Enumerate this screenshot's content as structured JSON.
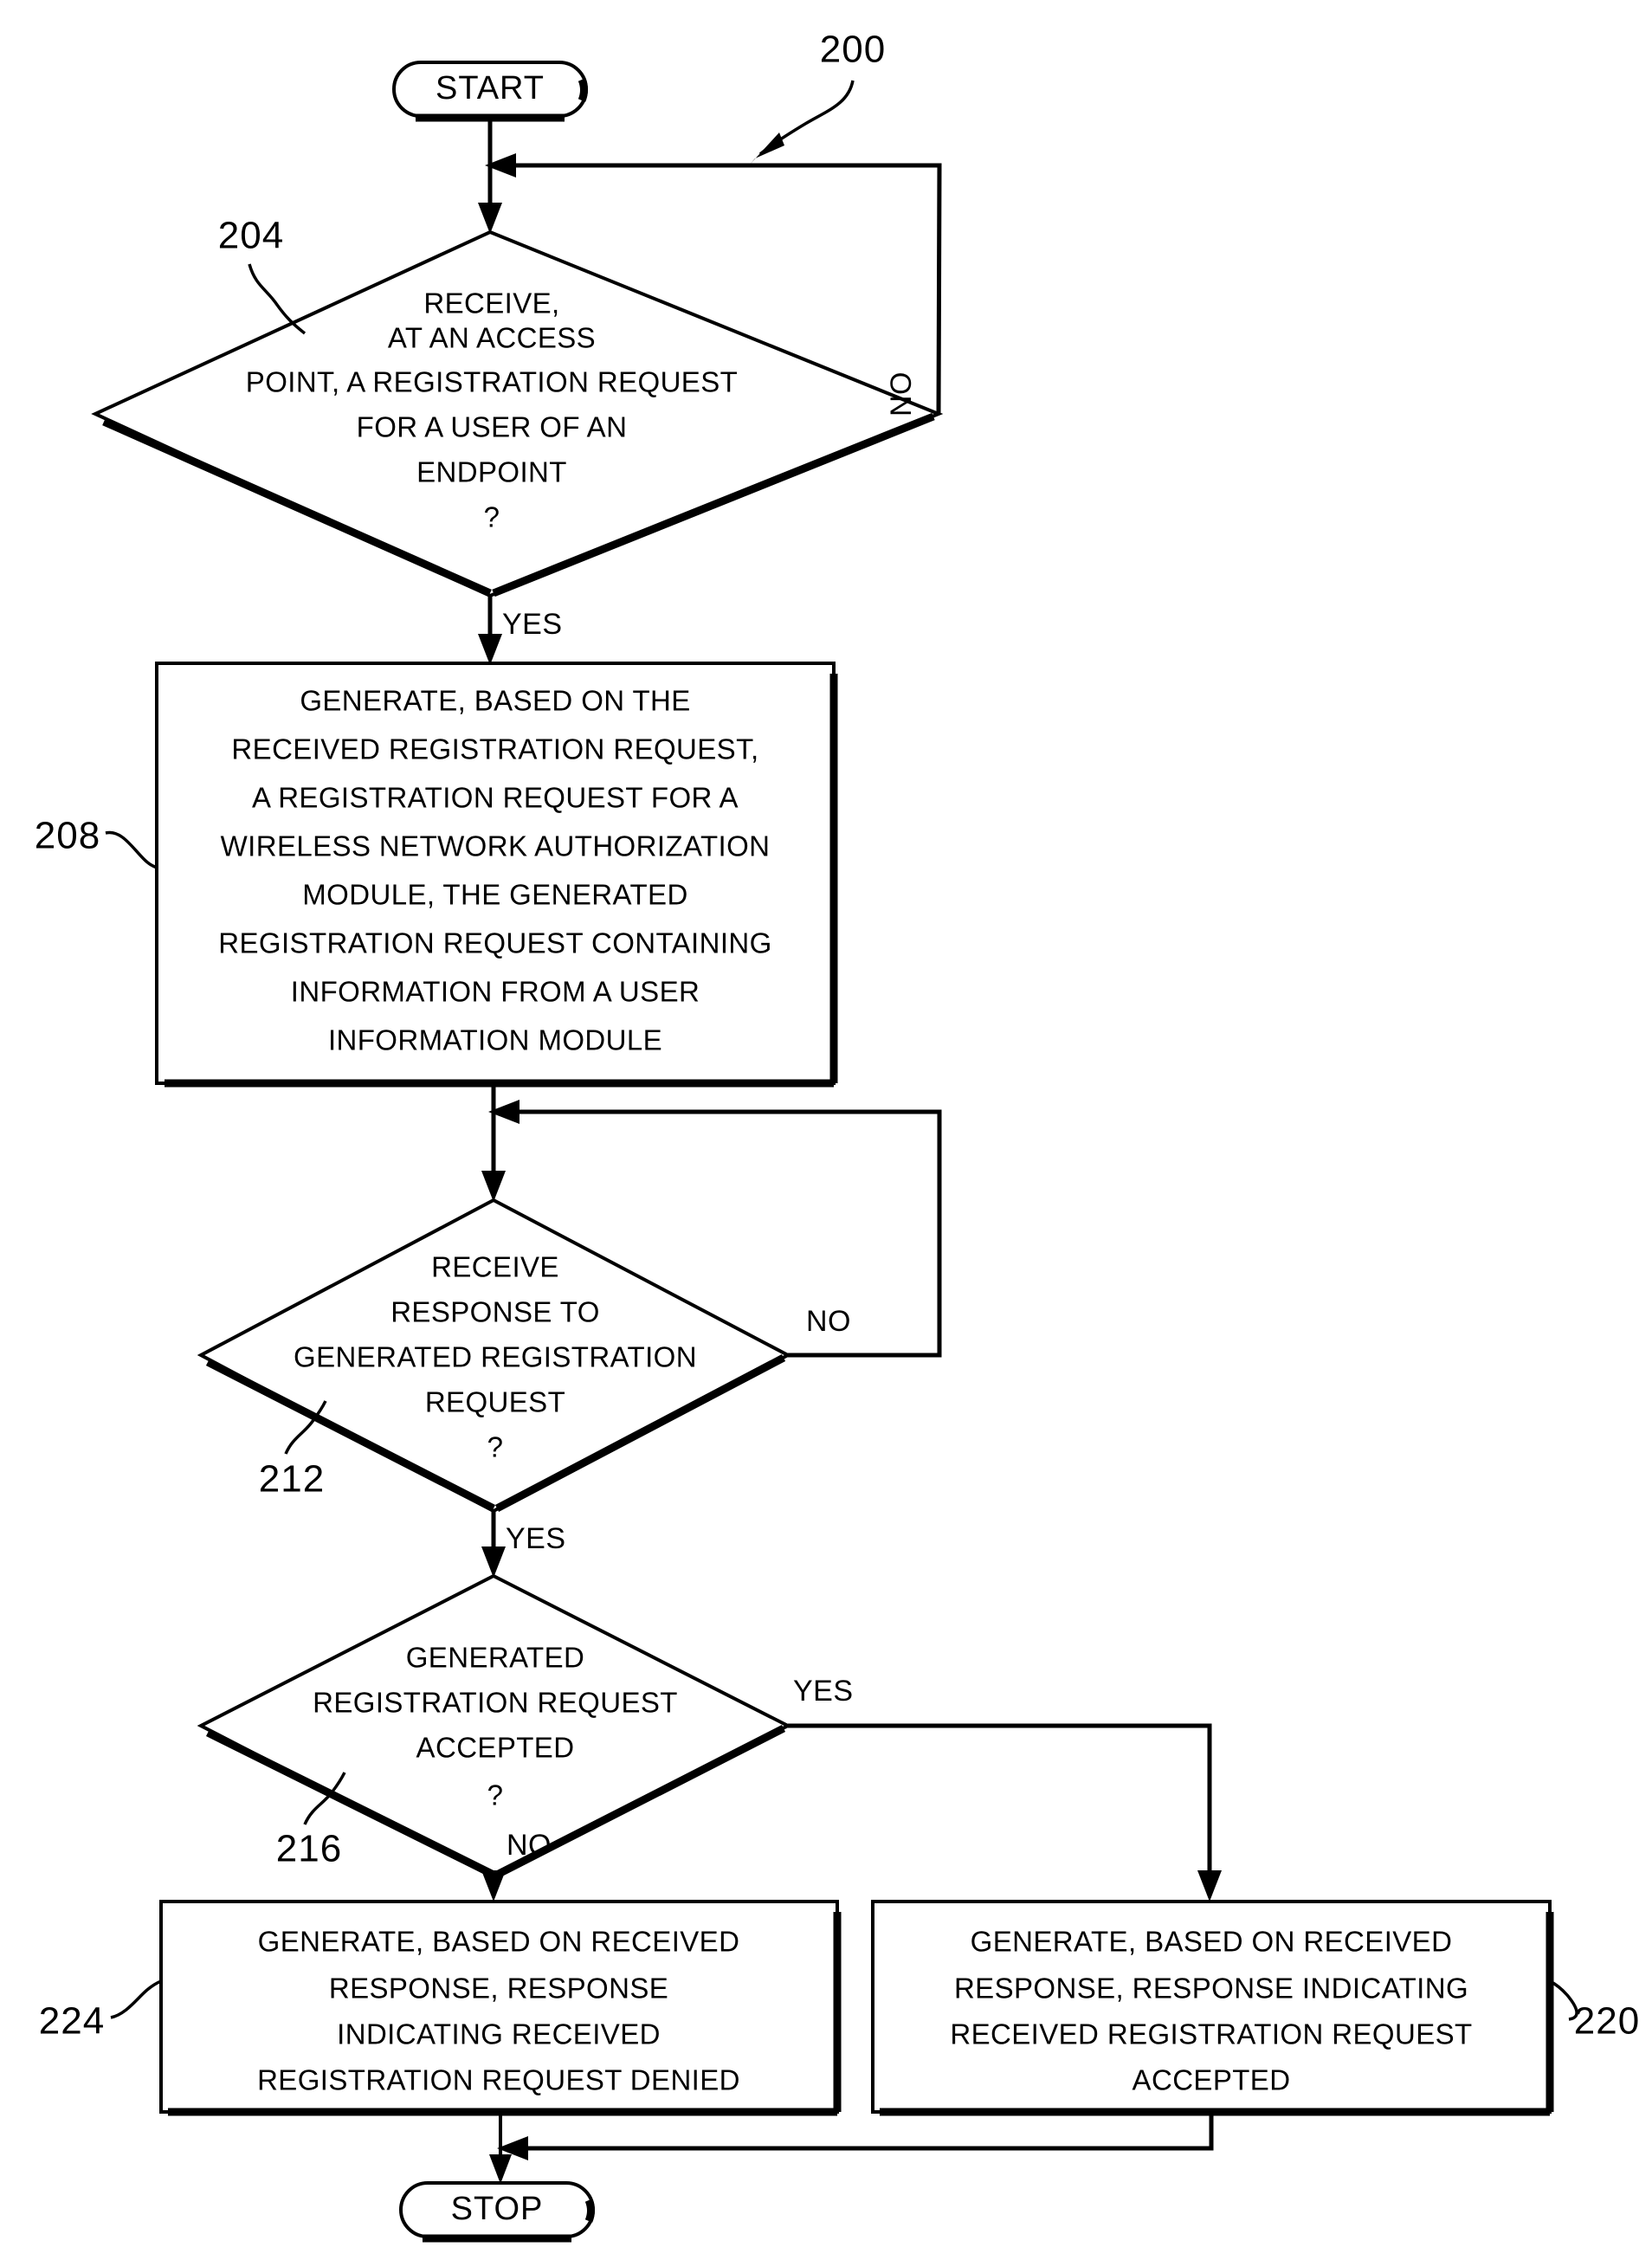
{
  "figure": {
    "reference_number": "200",
    "type": "patent-flowchart"
  },
  "nodes": {
    "start": {
      "label": "START",
      "shape": "terminator"
    },
    "decision_204": {
      "ref": "204",
      "shape": "diamond",
      "lines": [
        "RECEIVE,",
        "AT AN ACCESS",
        "POINT, A REGISTRATION REQUEST",
        "FOR A USER OF AN",
        "ENDPOINT",
        "?"
      ],
      "branch_no": "NO",
      "branch_yes": "YES"
    },
    "process_208": {
      "ref": "208",
      "shape": "rectangle",
      "lines": [
        "GENERATE, BASED ON THE",
        "RECEIVED REGISTRATION REQUEST,",
        "A REGISTRATION REQUEST FOR A",
        "WIRELESS NETWORK AUTHORIZATION",
        "MODULE, THE GENERATED",
        "REGISTRATION REQUEST CONTAINING",
        "INFORMATION FROM A USER",
        "INFORMATION MODULE"
      ]
    },
    "decision_212": {
      "ref": "212",
      "shape": "diamond",
      "lines": [
        "RECEIVE",
        "RESPONSE TO",
        "GENERATED REGISTRATION",
        "REQUEST",
        "?"
      ],
      "branch_no": "NO",
      "branch_yes": "YES"
    },
    "decision_216": {
      "ref": "216",
      "shape": "diamond",
      "lines": [
        "GENERATED",
        "REGISTRATION REQUEST",
        "ACCEPTED",
        "?"
      ],
      "branch_yes": "YES",
      "branch_no": "NO"
    },
    "process_224": {
      "ref": "224",
      "shape": "rectangle",
      "lines": [
        "GENERATE, BASED ON RECEIVED",
        "RESPONSE, RESPONSE",
        "INDICATING RECEIVED",
        "REGISTRATION REQUEST DENIED"
      ]
    },
    "process_220": {
      "ref": "220",
      "shape": "rectangle",
      "lines": [
        "GENERATE, BASED ON RECEIVED",
        "RESPONSE, RESPONSE INDICATING",
        "RECEIVED REGISTRATION REQUEST",
        "ACCEPTED"
      ]
    },
    "stop": {
      "label": "STOP",
      "shape": "terminator"
    }
  },
  "colors": {
    "line": "#000000",
    "fill": "#ffffff",
    "background": "#ffffff"
  }
}
